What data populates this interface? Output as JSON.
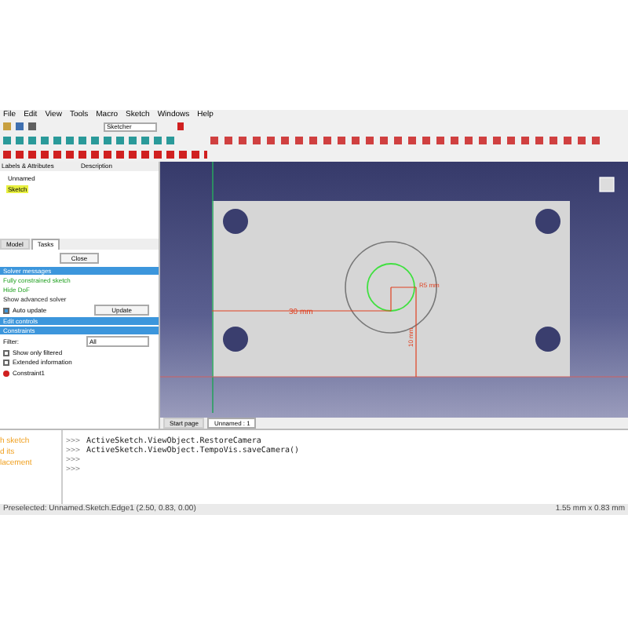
{
  "menu": [
    "File",
    "Edit",
    "View",
    "Tools",
    "Macro",
    "Sketch",
    "Windows",
    "Help"
  ],
  "workbench": "Sketcher",
  "tree": {
    "columns": [
      "Labels & Attributes",
      "Description"
    ],
    "items": [
      {
        "label": "Unnamed",
        "selected": false
      },
      {
        "label": "Sketch",
        "selected": true
      }
    ]
  },
  "panel_tabs": [
    {
      "label": "Model",
      "selected": false
    },
    {
      "label": "Tasks",
      "selected": true
    }
  ],
  "close_button": "Close",
  "sections": [
    {
      "title": "Solver messages",
      "lines": [
        {
          "text": "Fully constrained sketch",
          "kind": "ok"
        },
        {
          "text": "Hide DoF",
          "kind": "ok"
        },
        {
          "text": "Show advanced solver",
          "kind": "plain"
        }
      ],
      "auto_update": {
        "label": "Auto update",
        "checked": true
      },
      "button": "Update"
    },
    {
      "title": "Edit controls"
    },
    {
      "title": "Constraints",
      "filter_label": "Filter:",
      "filter_value": "All",
      "options": [
        {
          "label": "Show only filtered",
          "checked": false
        },
        {
          "label": "Extended information",
          "checked": false
        }
      ],
      "item": "Constraint1"
    }
  ],
  "view_tabs": [
    {
      "label": "Start page",
      "selected": false
    },
    {
      "label": "Unnamed : 1",
      "selected": true
    }
  ],
  "dimensions": {
    "horizontal": "30 mm",
    "vertical": "10 mm",
    "radius": "R5 mm"
  },
  "help_lines": [
    "h sketch",
    "d its",
    "lacement"
  ],
  "console": [
    {
      "prompt": ">>>",
      "code": "ActiveSketch.ViewObject.RestoreCamera"
    },
    {
      "prompt": ">>>",
      "code": "ActiveSketch.ViewObject.TempoVis.saveCamera()"
    },
    {
      "prompt": ">>>"
    },
    {
      "prompt": ">>>"
    }
  ],
  "status": {
    "left": "Preselected: Unnamed.Sketch.Edge1 (2.50, 0.83, 0.00)",
    "right": "1.55 mm x 0.83 mm"
  }
}
